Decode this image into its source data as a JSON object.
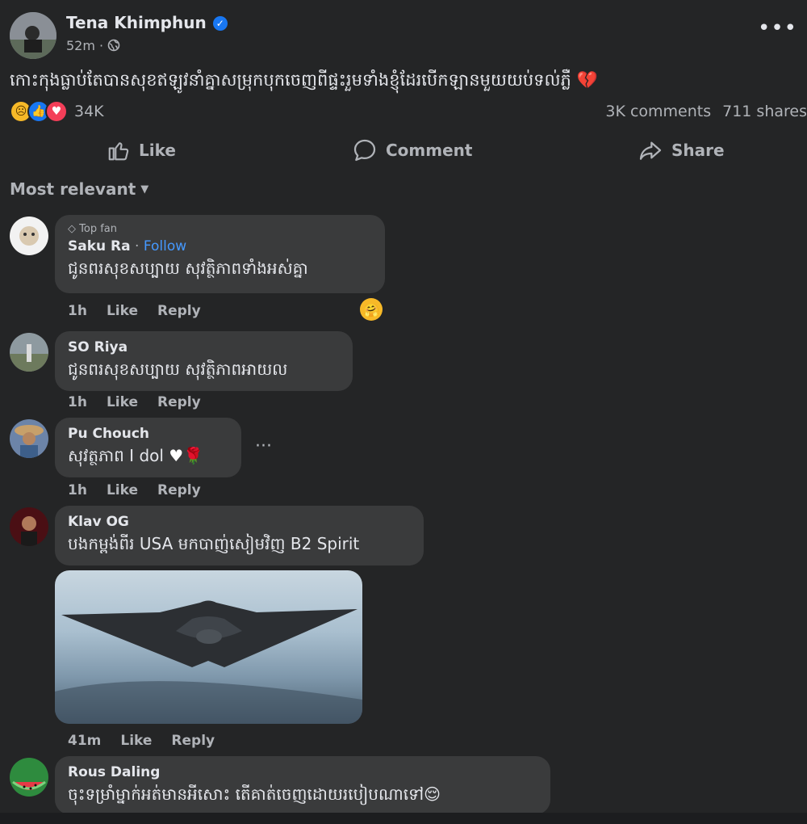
{
  "post": {
    "author": "Tena Khimphun",
    "time": "52m",
    "separator": "·",
    "text": "កោះកុងធ្លាប់តែបានសុខឥឡូវនាំគ្នាសម្រុកបុកចេញពីផ្ទះរួមទាំងខ្ញុំដែរបើកឡានមួយយប់ទល់ភ្លឺ",
    "reaction_count": "34K",
    "comments_count": "3K comments",
    "shares_count": "711 shares",
    "more_icon": "more-horizontal-icon"
  },
  "actions": {
    "like": "Like",
    "comment": "Comment",
    "share": "Share"
  },
  "sort_label": "Most relevant",
  "comments": [
    {
      "badge": "Top fan",
      "name": "Saku Ra",
      "follow": "Follow",
      "text": "ជូនពរសុខសប្បាយ សុវត្ថិភាពទាំងអស់គ្នា",
      "age": "1h",
      "like": "Like",
      "reply": "Reply"
    },
    {
      "name": "SO Riya",
      "text": "ជូនពរសុខសប្បាយ សុវត្ថិភាពអាយល",
      "age": "1h",
      "like": "Like",
      "reply": "Reply"
    },
    {
      "name": "Pu Chouch",
      "text": "សុវត្ថភាព I dol",
      "age": "1h",
      "like": "Like",
      "reply": "Reply"
    },
    {
      "name": "Klav OG",
      "text": "បងកម្ពង់ពីរ USA មកបាញ់សៀមវិញ B2 Spirit",
      "age": "41m",
      "like": "Like",
      "reply": "Reply"
    },
    {
      "name": "Rous Daling",
      "text": "ចុះទម្រាំម្នាក់អត់មានអីសោះ តើគាត់ចេញដោយរបៀបណាទៅ"
    }
  ],
  "colors": {
    "background": "#242526",
    "bubble": "#3a3b3c",
    "link": "#4599ff",
    "verified": "#1877f2"
  }
}
